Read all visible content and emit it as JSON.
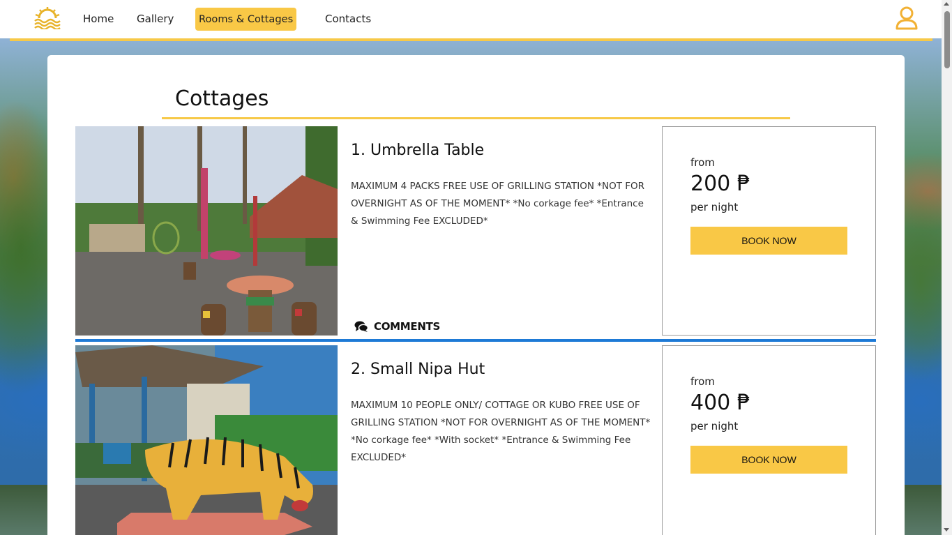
{
  "nav": {
    "items": [
      {
        "label": "Home",
        "active": false
      },
      {
        "label": "Gallery",
        "active": false
      },
      {
        "label": "Rooms & Cottages",
        "active": true
      },
      {
        "label": "Contacts",
        "active": false
      }
    ],
    "logo_icon": "sun-waves-icon",
    "user_icon": "user-icon"
  },
  "colors": {
    "accent": "#f9c846",
    "divider": "#1e7ad6",
    "panel": "#ffffff"
  },
  "section": {
    "title": "Cottages"
  },
  "cottages": [
    {
      "name": "1. Umbrella Table",
      "description": "MAXIMUM 4 PACKS FREE USE OF GRILLING STATION *NOT FOR OVERNIGHT AS OF THE MOMENT* *No corkage fee* *Entrance & Swimming Fee EXCLUDED*",
      "comments_label": "COMMENTS",
      "from_label": "from",
      "price": "200 ₱",
      "per_label": "per night",
      "book_label": "BOOK NOW"
    },
    {
      "name": "2. Small Nipa Hut",
      "description": "MAXIMUM 10 PEOPLE ONLY/ COTTAGE OR KUBO FREE USE OF GRILLING STATION *NOT FOR OVERNIGHT AS OF THE MOMENT* *No corkage fee* *With socket* *Entrance & Swimming Fee EXCLUDED*",
      "from_label": "from",
      "price": "400 ₱",
      "per_label": "per night",
      "book_label": "BOOK NOW"
    }
  ]
}
